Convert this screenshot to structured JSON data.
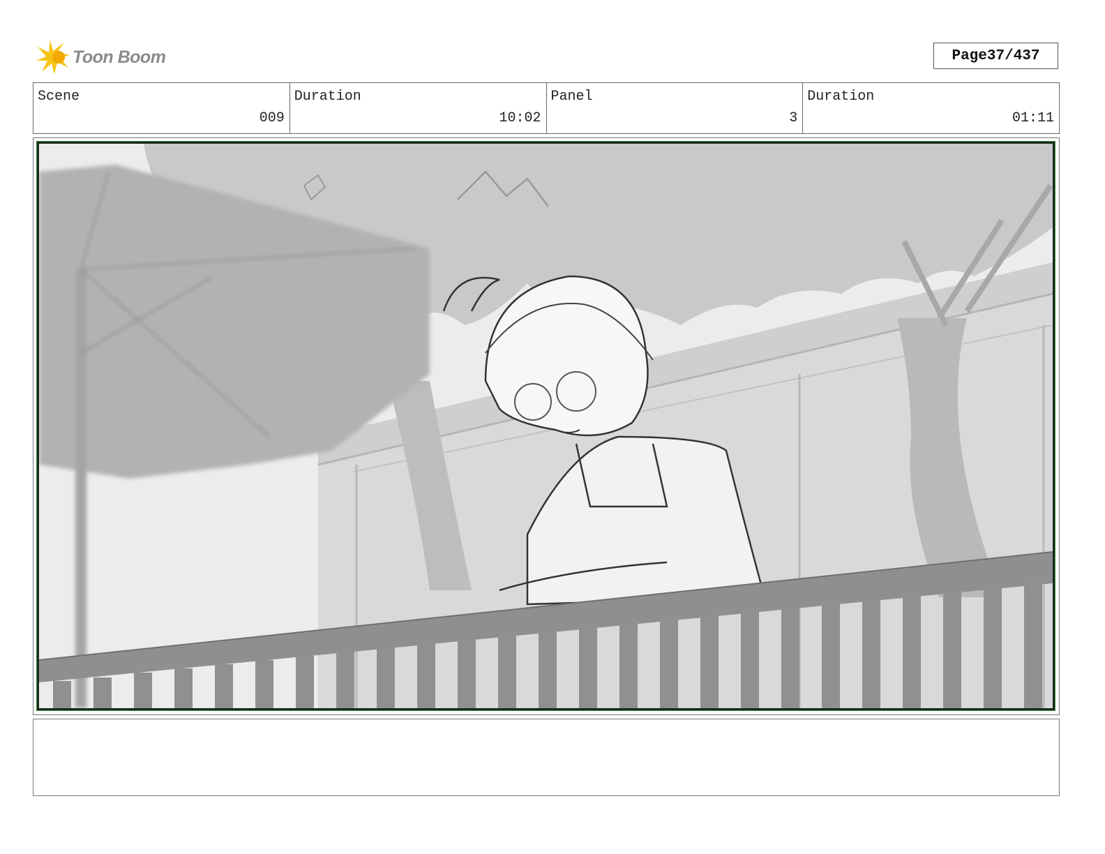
{
  "header": {
    "logo_text": "Toon Boom",
    "page_label": "Page",
    "page_number": "37/437"
  },
  "info": {
    "scene_label": "Scene",
    "scene_value": "009",
    "scene_duration_label": "Duration",
    "scene_duration_value": "10:02",
    "panel_label": "Panel",
    "panel_value": "3",
    "panel_duration_label": "Duration",
    "panel_duration_value": "01:11"
  },
  "panel": {
    "illustration": "storyboard-sketch-railing-scene"
  },
  "notes": {
    "text": ""
  },
  "colors": {
    "logo_accent": "#f2b705",
    "frame_border": "#1c2a1c",
    "frame_outline": "#3a8a3a"
  }
}
